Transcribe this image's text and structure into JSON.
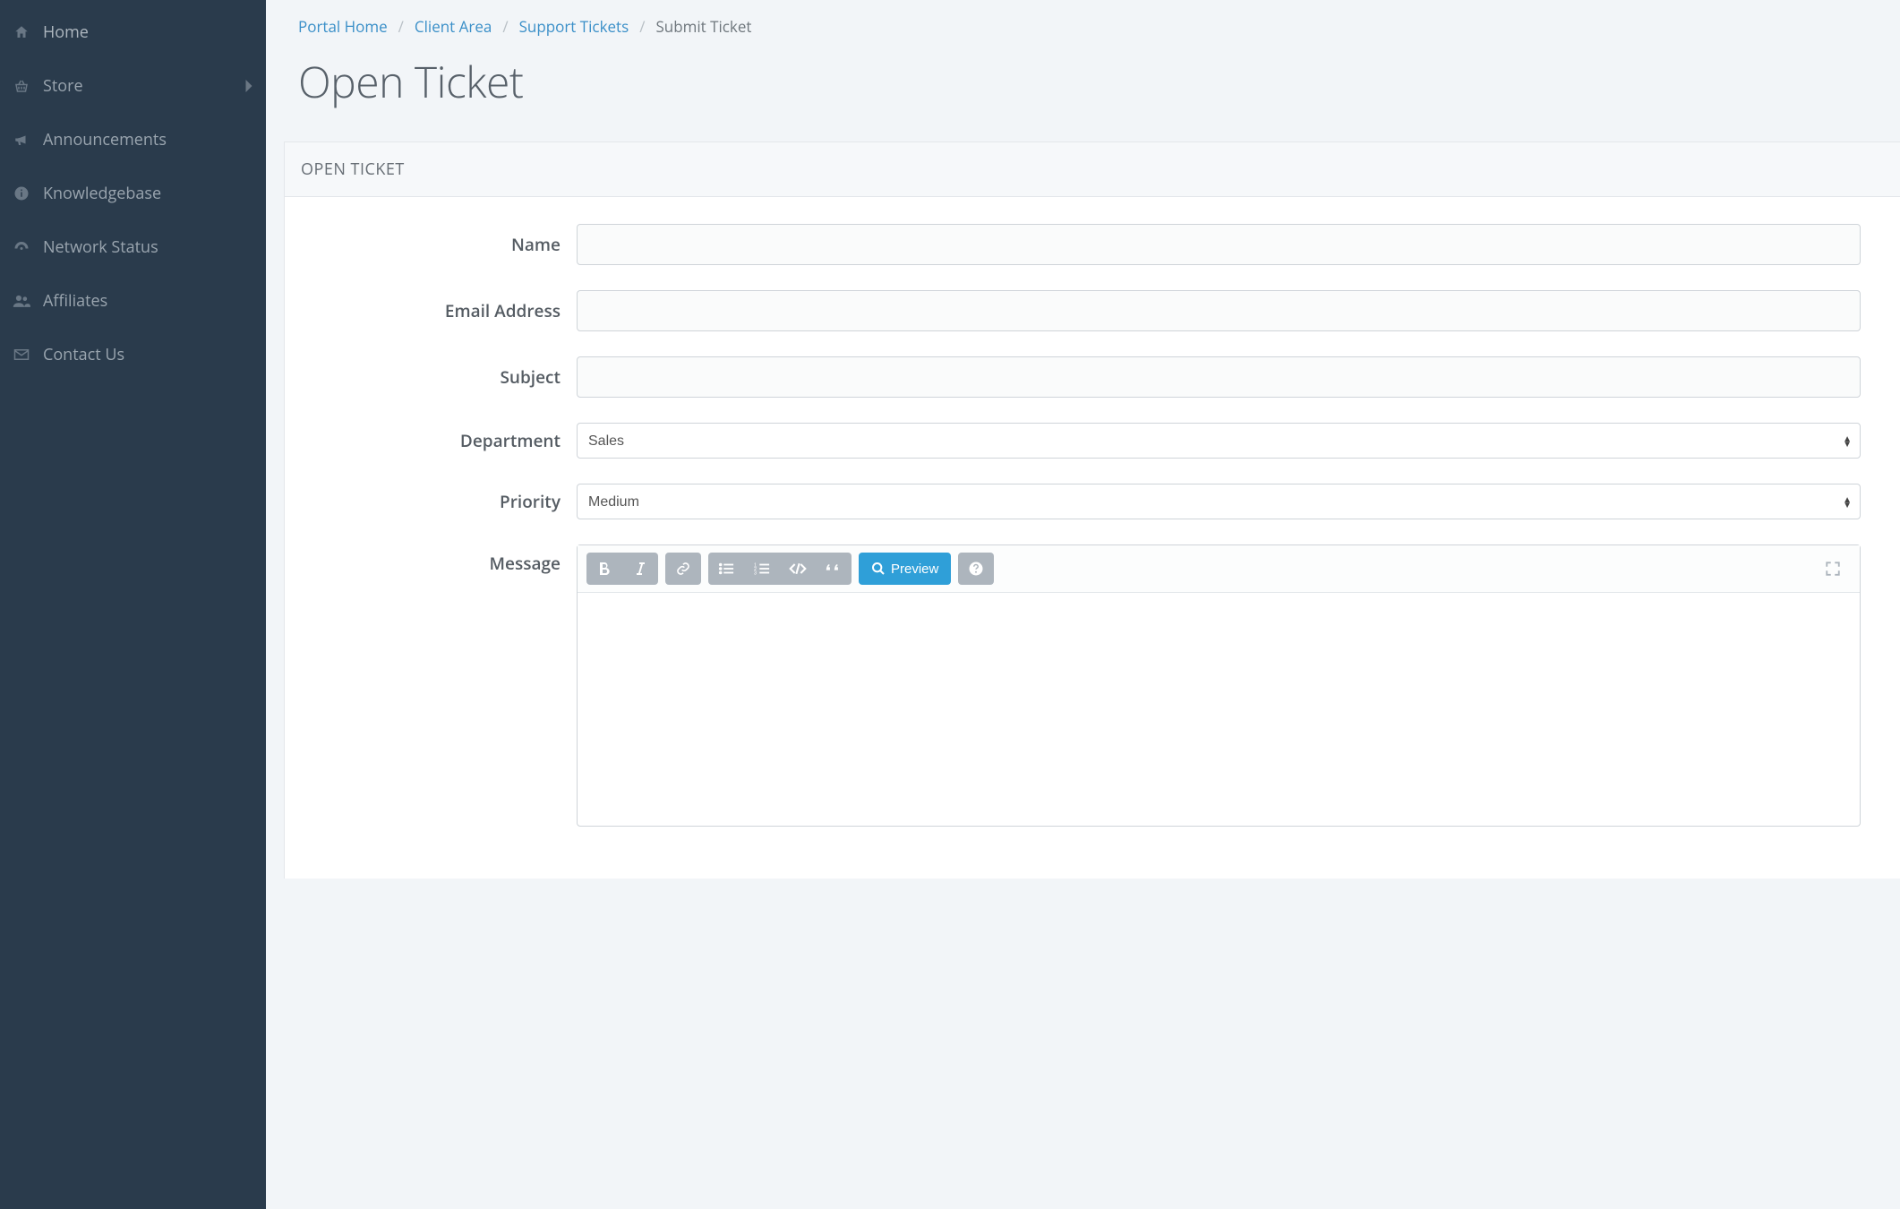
{
  "sidebar": {
    "items": [
      {
        "label": "Home"
      },
      {
        "label": "Store"
      },
      {
        "label": "Announcements"
      },
      {
        "label": "Knowledgebase"
      },
      {
        "label": "Network Status"
      },
      {
        "label": "Affiliates"
      },
      {
        "label": "Contact Us"
      }
    ]
  },
  "breadcrumb": {
    "items": [
      {
        "label": "Portal Home",
        "link": true
      },
      {
        "label": "Client Area",
        "link": true
      },
      {
        "label": "Support Tickets",
        "link": true
      },
      {
        "label": "Submit Ticket",
        "link": false
      }
    ],
    "separator": "/"
  },
  "page": {
    "title": "Open Ticket",
    "panel_title": "OPEN TICKET"
  },
  "form": {
    "name": {
      "label": "Name",
      "value": ""
    },
    "email": {
      "label": "Email Address",
      "value": ""
    },
    "subject": {
      "label": "Subject",
      "value": ""
    },
    "department": {
      "label": "Department",
      "selected": "Sales"
    },
    "priority": {
      "label": "Priority",
      "selected": "Medium"
    },
    "message": {
      "label": "Message"
    }
  },
  "editor": {
    "preview_label": "Preview"
  }
}
